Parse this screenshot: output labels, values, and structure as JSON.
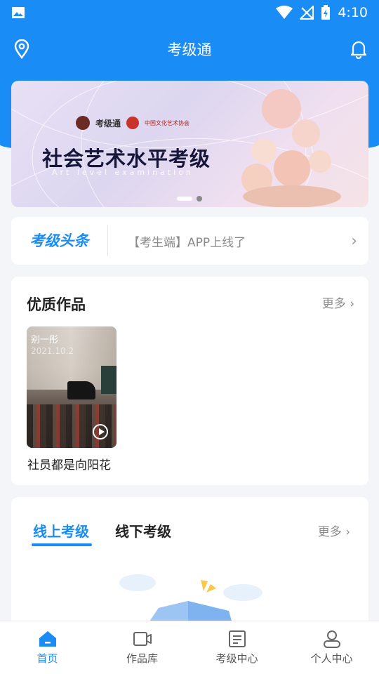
{
  "status": {
    "time": "4:10"
  },
  "nav": {
    "title": "考级通"
  },
  "banner": {
    "title": "社会艺术水平考级",
    "subtitle": "Art level examination",
    "logo1": "考级通",
    "logo2": "中国文化艺术协会",
    "logo2_en": "China Art Association"
  },
  "headline": {
    "brand": "考级头条",
    "message": "【考生端】APP上线了"
  },
  "works": {
    "title": "优质作品",
    "more": "更多",
    "items": [
      {
        "overlay_name": "别一彤",
        "overlay_date": "2021.10.2",
        "caption": "社员都是向阳花"
      }
    ]
  },
  "exam": {
    "tabs": [
      {
        "label": "线上考级",
        "active": true
      },
      {
        "label": "线下考级",
        "active": false
      }
    ],
    "more": "更多"
  },
  "tabbar": [
    {
      "label": "首页",
      "icon": "home-icon",
      "active": true
    },
    {
      "label": "作品库",
      "icon": "video-icon",
      "active": false
    },
    {
      "label": "考级中心",
      "icon": "document-icon",
      "active": false
    },
    {
      "label": "个人中心",
      "icon": "user-icon",
      "active": false
    }
  ],
  "colors": {
    "primary": "#1a8cf5",
    "background": "#f3f5f8"
  }
}
